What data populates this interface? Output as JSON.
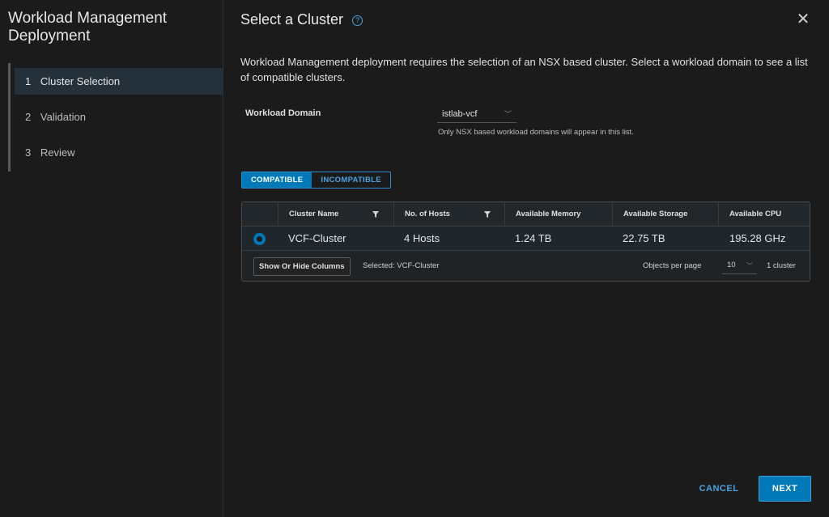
{
  "wizard": {
    "title": "Workload Management Deployment",
    "steps": [
      {
        "num": "1",
        "label": "Cluster Selection",
        "active": true
      },
      {
        "num": "2",
        "label": "Validation",
        "active": false
      },
      {
        "num": "3",
        "label": "Review",
        "active": false
      }
    ]
  },
  "dialog": {
    "title": "Select a Cluster",
    "help_icon": "?",
    "close_icon": "✕",
    "description": "Workload Management deployment requires the selection of an NSX based cluster. Select a workload domain to see a list of compatible clusters."
  },
  "workload_domain": {
    "label": "Workload Domain",
    "value": "istlab-vcf",
    "help": "Only NSX based workload domains will appear in this list."
  },
  "filter_toggle": {
    "compatible": "COMPATIBLE",
    "incompatible": "INCOMPATIBLE",
    "selected": "compatible"
  },
  "table": {
    "columns": [
      "Cluster Name",
      "No. of Hosts",
      "Available Memory",
      "Available Storage",
      "Available CPU"
    ],
    "rows": [
      {
        "selected": true,
        "cells": [
          "VCF-Cluster",
          "4 Hosts",
          "1.24 TB",
          "22.75 TB",
          "195.28 GHz"
        ]
      }
    ],
    "footer": {
      "columns_button": "Show Or Hide Columns",
      "selected_text": "Selected: VCF-Cluster",
      "objects_per_page_label": "Objects per page",
      "objects_per_page_value": "10",
      "count_text": "1 cluster"
    }
  },
  "actions": {
    "cancel": "CANCEL",
    "next": "NEXT"
  },
  "colors": {
    "accent": "#0079b8",
    "link": "#4aa3df",
    "background": "#1b1b1b"
  }
}
